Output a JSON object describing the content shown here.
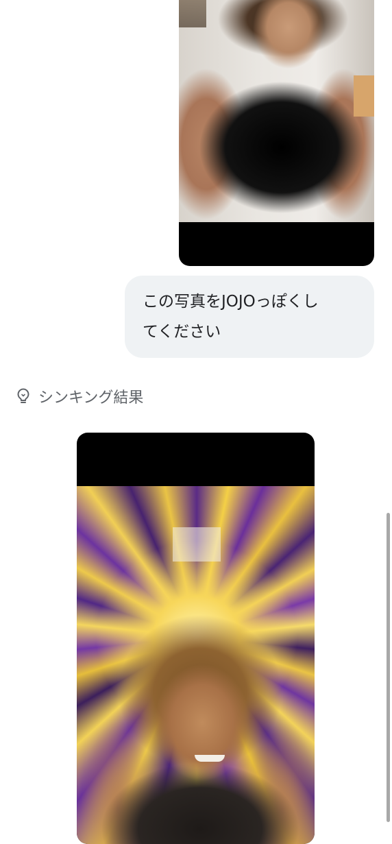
{
  "conversation": {
    "user_message": {
      "line1": "この写真をJOJOっぽくし",
      "line2": "てください"
    },
    "thinking": {
      "label": "シンキング結果",
      "icon": "lightbulb-icon"
    }
  },
  "colors": {
    "bubble_background": "#eff2f4",
    "text_primary": "#202124",
    "text_secondary": "#5f6368",
    "scrollbar": "#a8a8a8"
  }
}
